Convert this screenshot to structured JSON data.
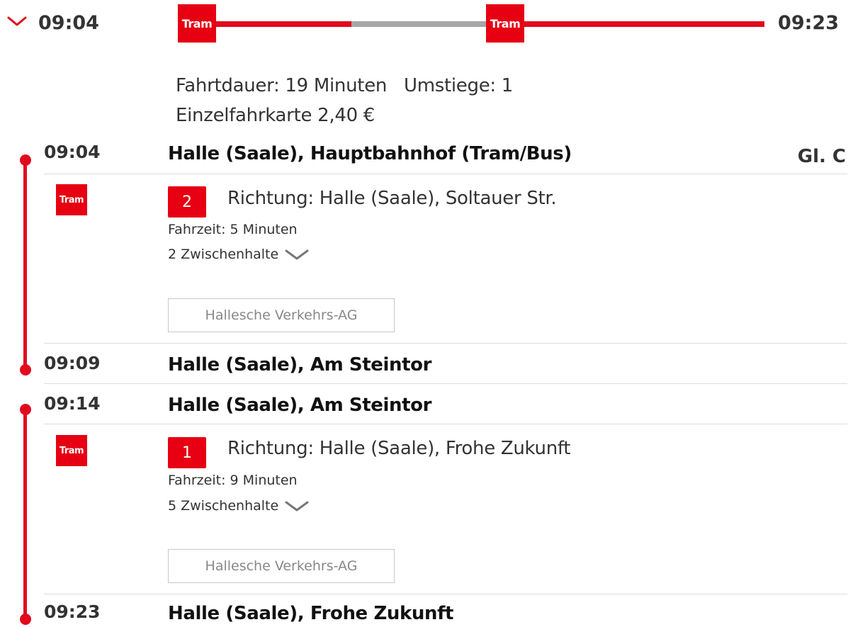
{
  "summary": {
    "departure_time": "09:04",
    "arrival_time": "09:23",
    "duration_label": "Fahrtdauer: 19 Minuten",
    "transfers_label": "Umstiege: 1",
    "fare_label": "Einzelfahrkarte 2,40 €",
    "segments": [
      {
        "mode": "Tram",
        "status": "ride"
      },
      {
        "mode": "walk",
        "status": "transfer"
      },
      {
        "mode": "Tram",
        "status": "ride"
      }
    ]
  },
  "mode_label": "Tram",
  "legs": [
    {
      "dep_time": "09:04",
      "dep_stop": "Halle (Saale), Hauptbahnhof (Tram/Bus)",
      "platform": "Gl. C",
      "line": "2",
      "direction": "Richtung: Halle (Saale), Soltauer Str.",
      "duration": "Fahrzeit: 5 Minuten",
      "stops": "2 Zwischenhalte",
      "operator": "Hallesche Verkehrs-AG",
      "arr_time": "09:09",
      "arr_stop": "Halle (Saale), Am Steintor"
    },
    {
      "dep_time": "09:14",
      "dep_stop": "Halle (Saale), Am Steintor",
      "line": "1",
      "direction": "Richtung: Halle (Saale), Frohe Zukunft",
      "duration": "Fahrzeit: 9 Minuten",
      "stops": "5 Zwischenhalte",
      "operator": "Hallesche Verkehrs-AG",
      "arr_time": "09:23",
      "arr_stop": "Halle (Saale), Frohe Zukunft"
    }
  ],
  "colors": {
    "accent": "#e10a1e",
    "transfer": "#a7a7a7",
    "text": "#333333",
    "divider": "#dcdcdc"
  }
}
